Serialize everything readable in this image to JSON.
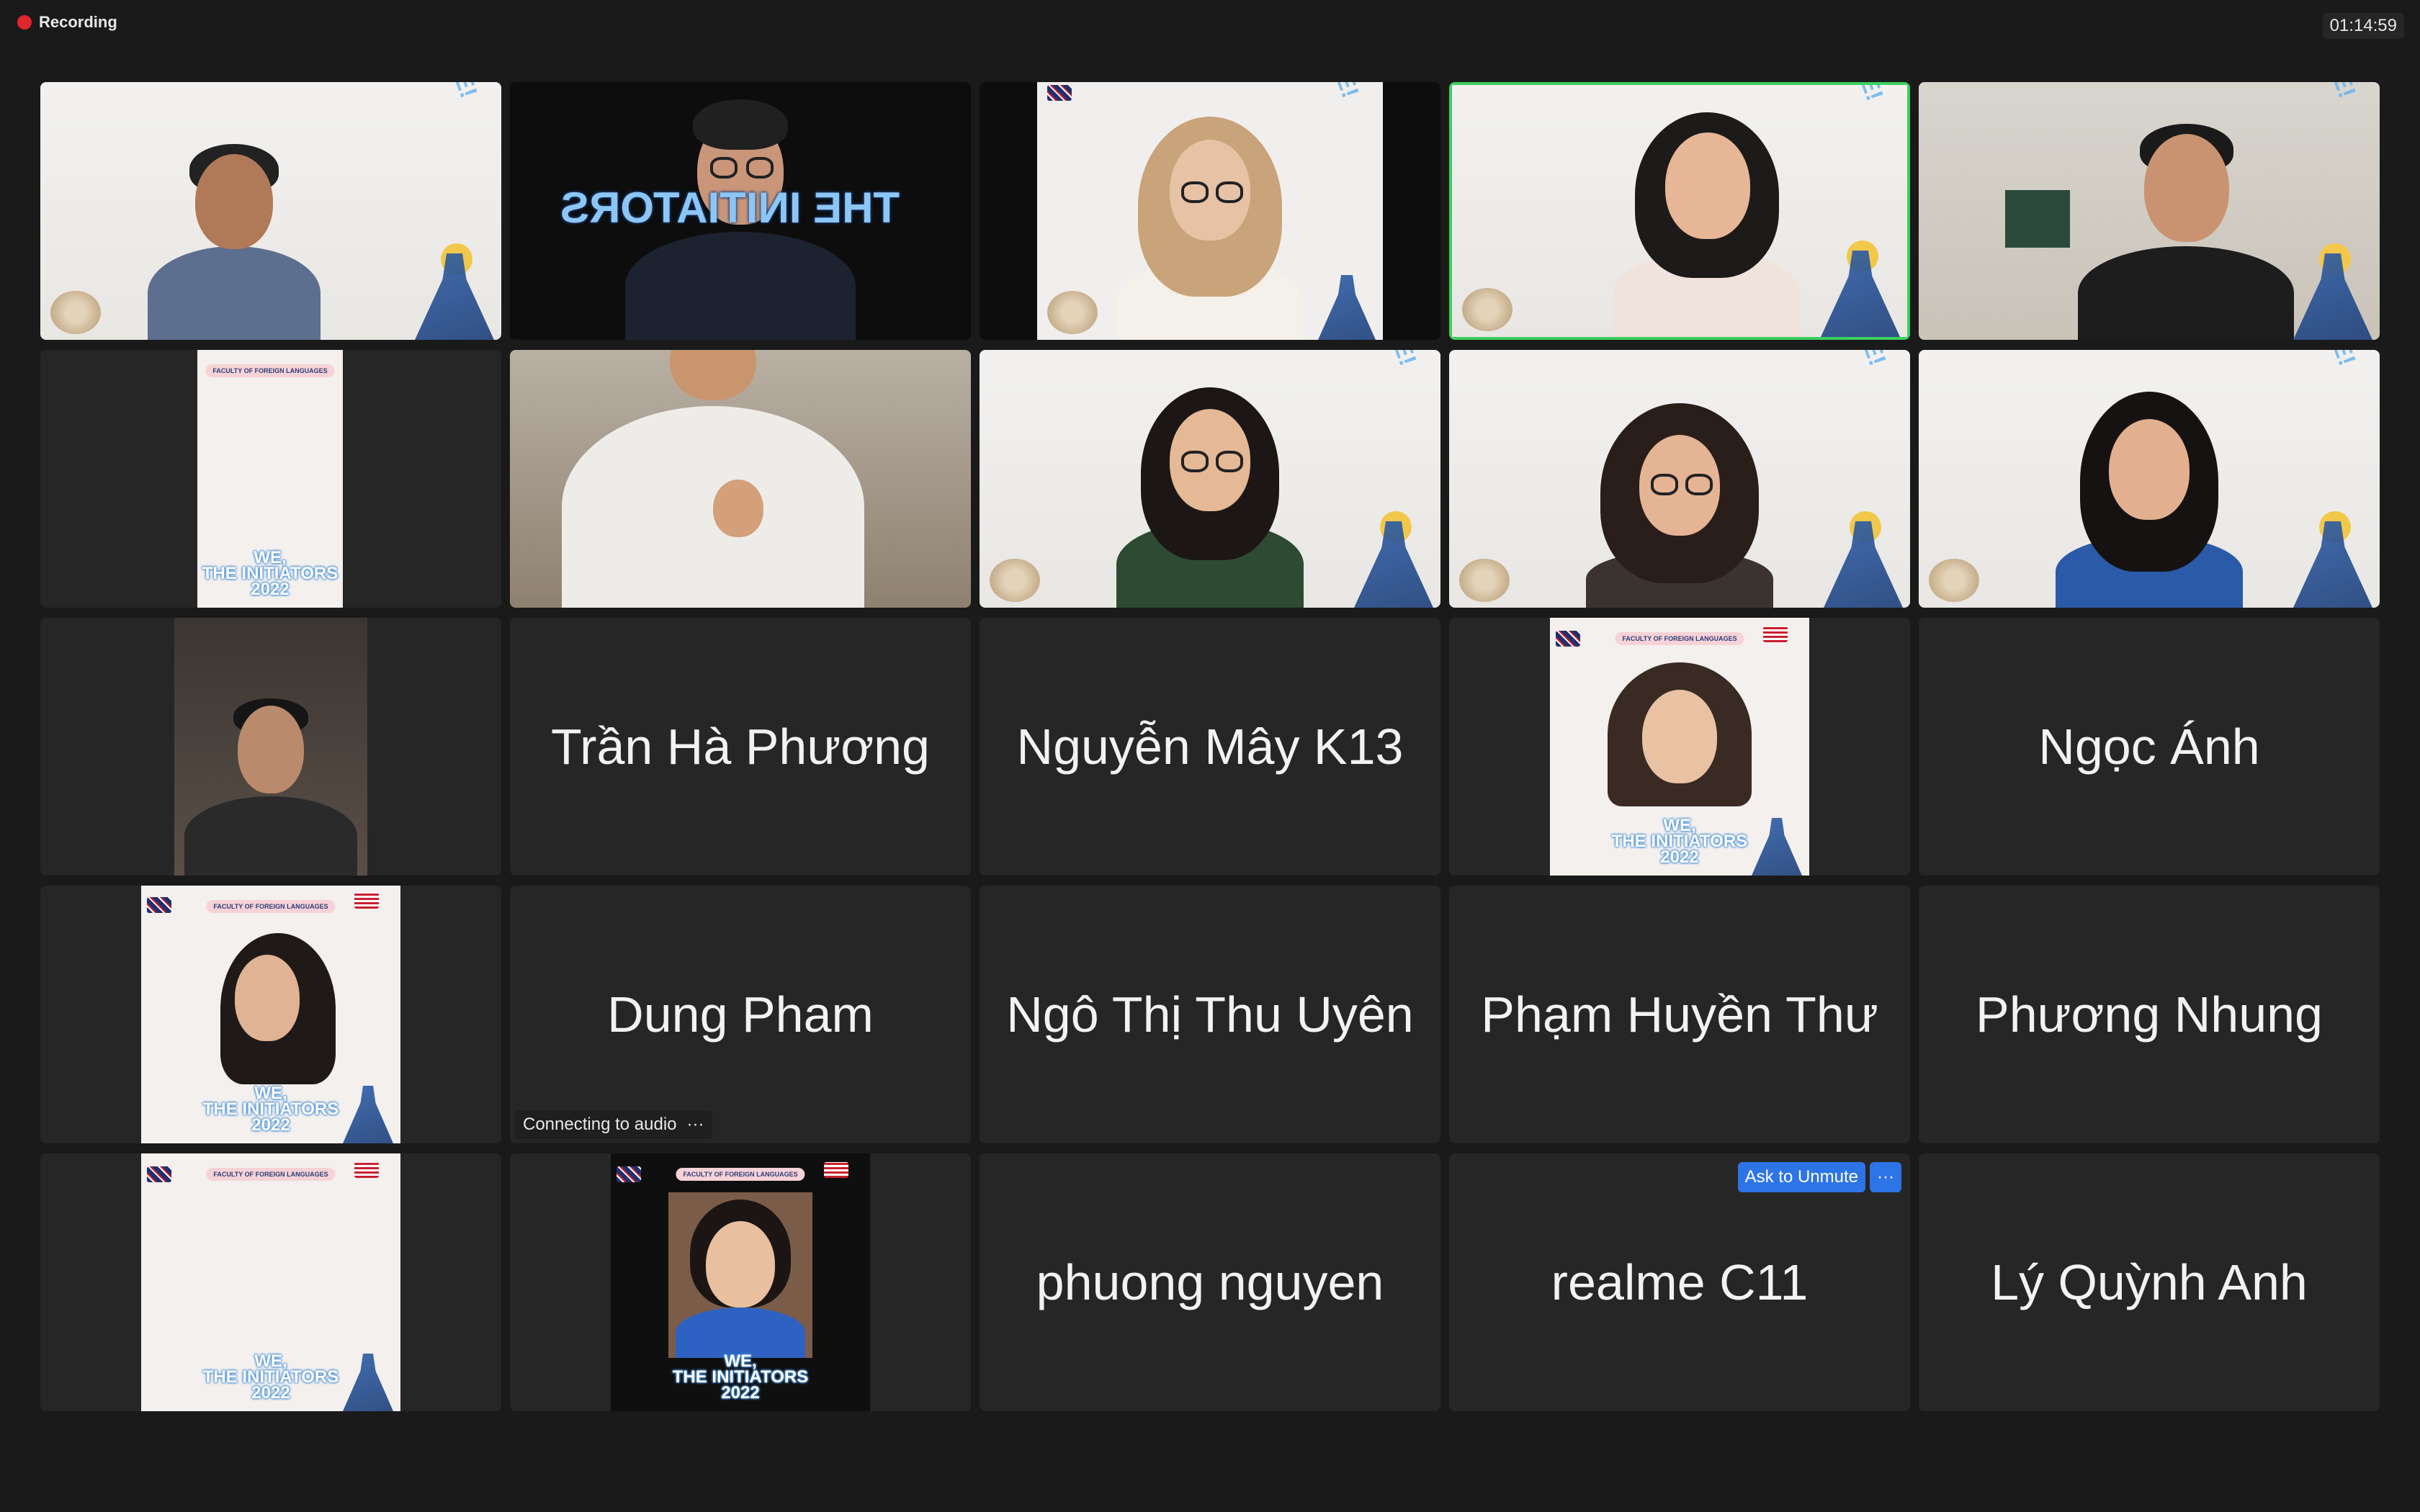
{
  "top_bar": {
    "recording_label": "Recording",
    "clock": "01:14:59"
  },
  "poster": {
    "header": "FACULTY OF FOREIGN LANGUAGES",
    "title_line1": "WE,",
    "title_line2": "THE INITIATORS",
    "title_year": "2022",
    "welcome": "WELCOME!",
    "cohort": "K13",
    "mirrored_banner": "THE INITIATORS"
  },
  "tiles": {
    "t13": {
      "name": "Trần Hà Phương"
    },
    "t14": {
      "name": "Nguyễn Mây K13"
    },
    "t16": {
      "name": "Ngọc Ánh"
    },
    "t18": {
      "name": "Dung Pham",
      "status": "Connecting to audio",
      "status_more": "···"
    },
    "t19": {
      "name": "Ngô Thị Thu Uyên"
    },
    "t20": {
      "name": "Phạm Huyền Thư"
    },
    "t21": {
      "name": "Phương Nhung"
    },
    "t24": {
      "name": "phuong nguyen"
    },
    "t25": {
      "name": "realme C11",
      "unmute_label": "Ask to Unmute",
      "more_label": "···"
    },
    "t26": {
      "name": "Lý Quỳnh Anh"
    }
  },
  "colors": {
    "background": "#1a1a1a",
    "tile": "#262626",
    "active_speaker_border": "#3ccf5e",
    "recording_dot": "#e0252b",
    "button_blue": "#2d74e6"
  }
}
